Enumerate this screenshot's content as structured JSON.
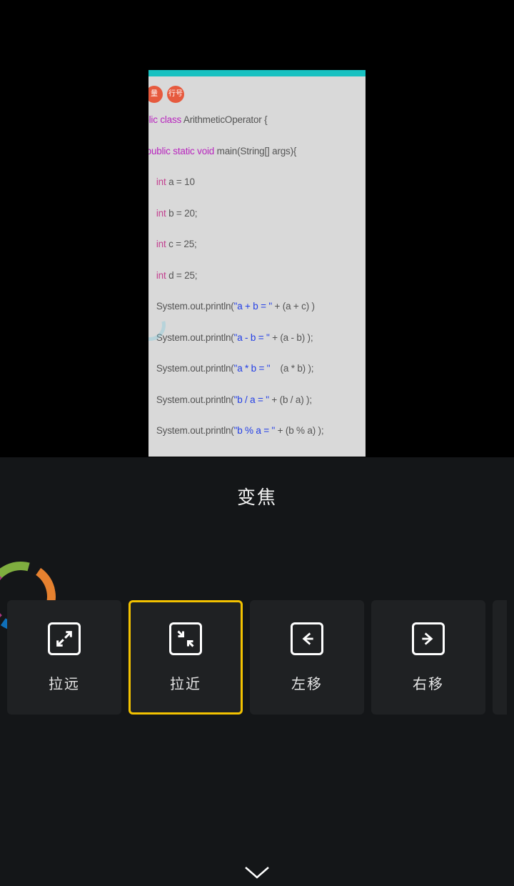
{
  "preview": {
    "badges": [
      "量",
      "行号"
    ],
    "code": {
      "l1_kw": "ublic class ",
      "l1_id": "ArithmeticOperator {",
      "l2_kw": "public static void ",
      "l2_id": "main(String[] args){",
      "l3_kw": "int ",
      "l3_id": "a = 10",
      "l4_kw": "int ",
      "l4_id": "b = 20;",
      "l5_kw": "int ",
      "l5_id": "c = 25;",
      "l6_kw": "int ",
      "l6_id": "d = 25;",
      "p_prefix": "System.out.println(",
      "p1_str": "\"a + b = \"",
      "p1_tail": " + (a + c) )",
      "p2_str": "\"a - b = \"",
      "p2_tail": " + (a - b) );",
      "p3_str": "\"a * b = \"",
      "p3_tail": "    (a * b) );",
      "p4_str": "\"b / a = \"",
      "p4_tail": " + (b / a) );",
      "p5_str": "\"b % a = \"",
      "p5_tail": " + (b % a) );"
    }
  },
  "panel": {
    "title": "变焦",
    "cards": [
      {
        "label": "拉远",
        "icon": "zoom-out"
      },
      {
        "label": "拉近",
        "icon": "zoom-in"
      },
      {
        "label": "左移",
        "icon": "move-left"
      },
      {
        "label": "右移",
        "icon": "move-right"
      }
    ],
    "selected_index": 1
  }
}
